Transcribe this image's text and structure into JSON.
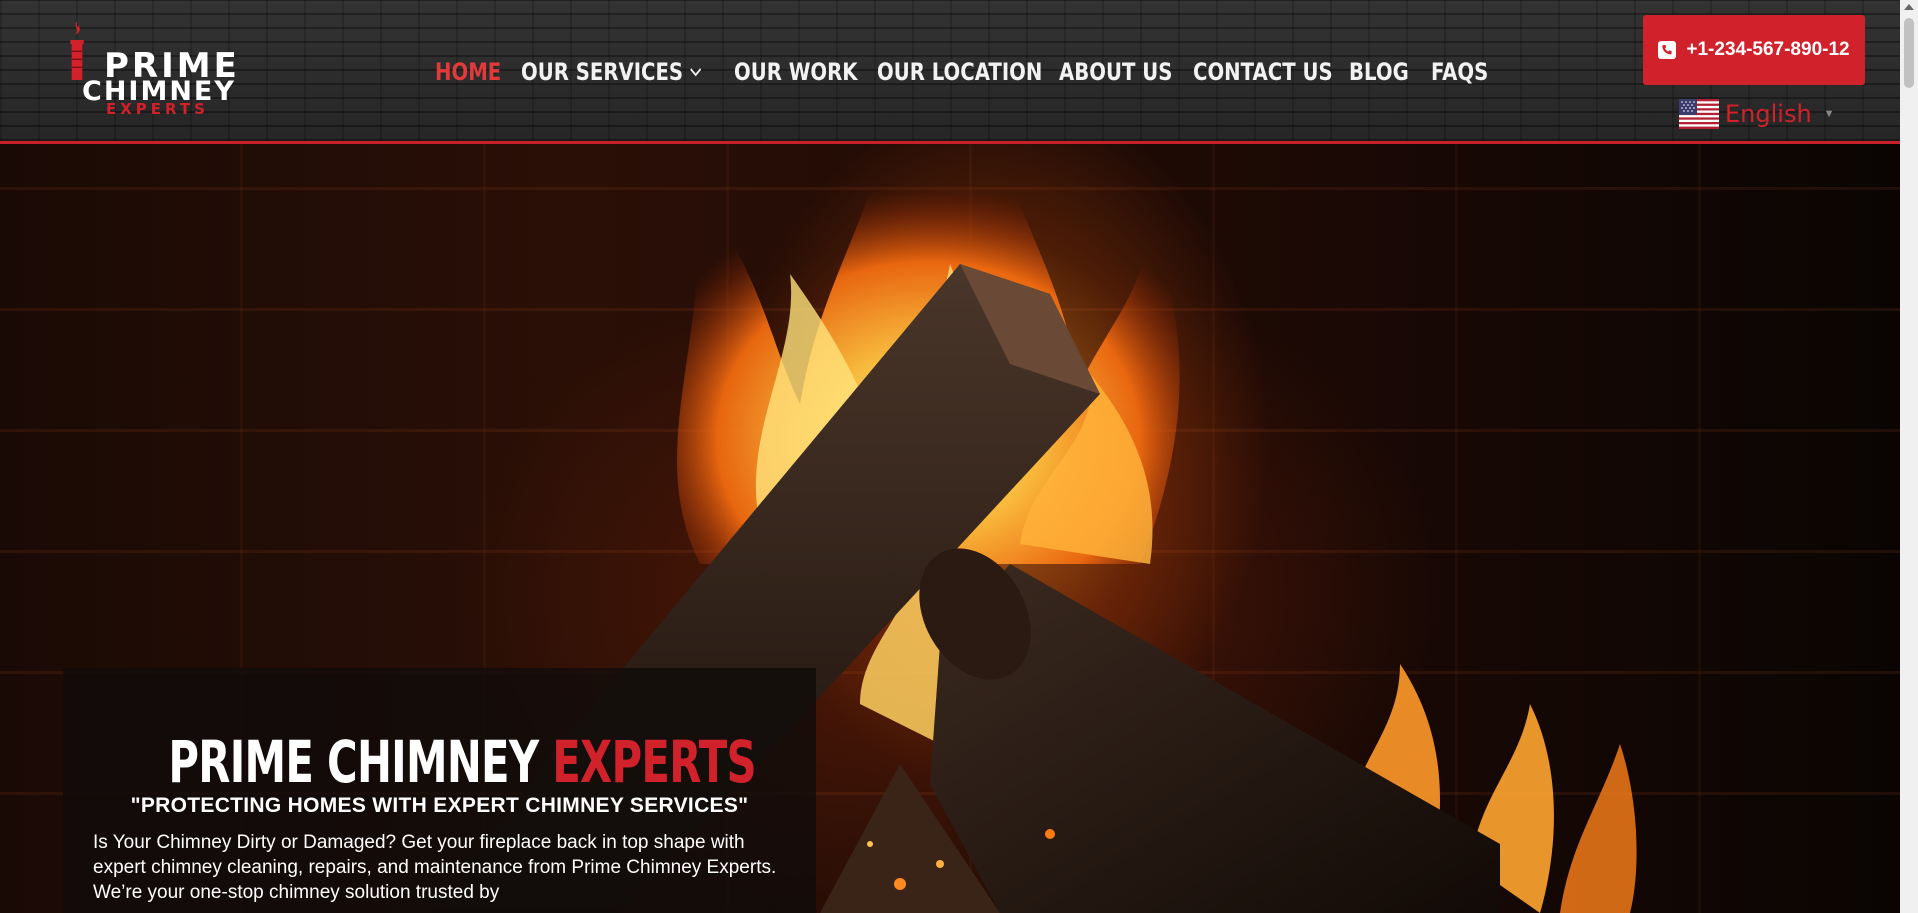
{
  "brand": {
    "logo_line1": "PRIME",
    "logo_line2": "CHIMNEY",
    "logo_line3": "EXPERTS",
    "accent_color": "#d1222b"
  },
  "nav": {
    "items": [
      {
        "label": "HOME",
        "active": true
      },
      {
        "label": "OUR SERVICES",
        "has_dropdown": true
      },
      {
        "label": "OUR WORK"
      },
      {
        "label": "OUR LOCATION"
      },
      {
        "label": "ABOUT US"
      },
      {
        "label": "CONTACT US"
      },
      {
        "label": "BLOG"
      },
      {
        "label": "FAQS"
      }
    ]
  },
  "header_actions": {
    "phone": "+1-234-567-890-12",
    "phone_icon": "phone-icon",
    "language": "English",
    "language_flag": "us-flag-icon"
  },
  "hero": {
    "title_part1": "PRIME CHIMNEY",
    "title_part2": "EXPERTS",
    "subtitle": "\"PROTECTING HOMES WITH EXPERT CHIMNEY SERVICES\"",
    "description": "Is Your Chimney Dirty or Damaged? Get your fireplace back in top shape with expert chimney cleaning, repairs, and maintenance from Prime Chimney Experts. We’re your one-stop chimney solution trusted by"
  }
}
